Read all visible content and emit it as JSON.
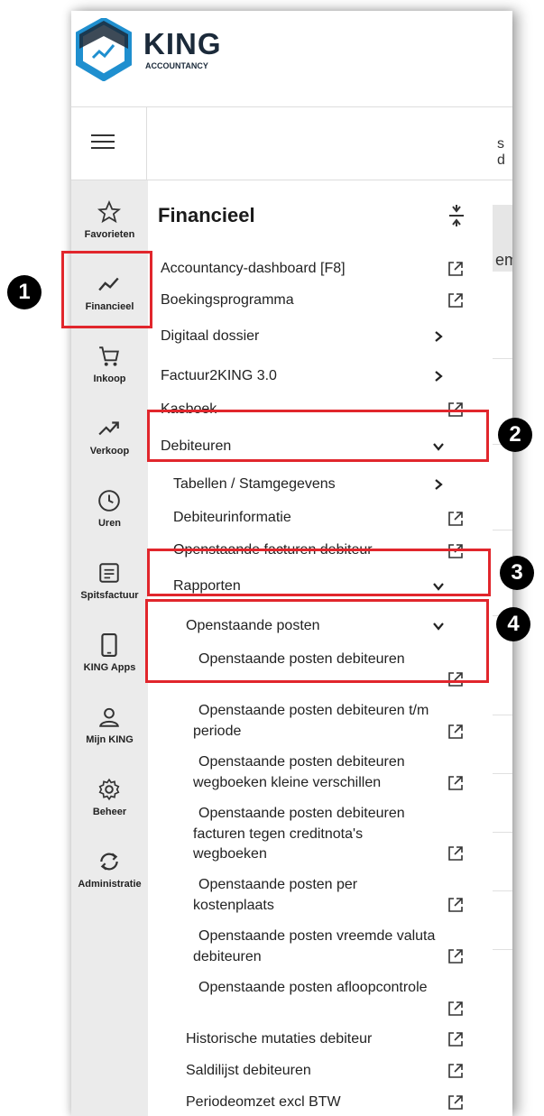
{
  "brand": {
    "name": "KING",
    "sub": "ACCOUNTANCY"
  },
  "topbar": {
    "peek_text": "s d"
  },
  "rail": [
    {
      "label": "Favorieten",
      "icon": "star-icon"
    },
    {
      "label": "Financieel",
      "icon": "line-chart-icon",
      "active": true
    },
    {
      "label": "Inkoop",
      "icon": "cart-icon"
    },
    {
      "label": "Verkoop",
      "icon": "trending-up-icon"
    },
    {
      "label": "Uren",
      "icon": "clock-icon"
    },
    {
      "label": "Spitsfactuur",
      "icon": "document-icon"
    },
    {
      "label": "KING Apps",
      "icon": "phone-icon"
    },
    {
      "label": "Mijn KING",
      "icon": "user-icon"
    },
    {
      "label": "Beheer",
      "icon": "gear-icon"
    },
    {
      "label": "Administratie",
      "icon": "sync-icon"
    }
  ],
  "panel": {
    "title": "Financieel",
    "items": [
      {
        "label": "Accountancy-dashboard [F8]",
        "kind": "external"
      },
      {
        "label": "Boekingsprogramma",
        "kind": "external"
      },
      {
        "label": "Digitaal dossier",
        "kind": "submenu"
      },
      {
        "label": "Factuur2KING 3.0",
        "kind": "submenu"
      },
      {
        "label": "Kasboek",
        "kind": "external"
      },
      {
        "label": "Debiteuren",
        "kind": "expanded"
      },
      {
        "label": "Tabellen / Stamgegevens",
        "kind": "submenu"
      },
      {
        "label": "Debiteurinformatie",
        "kind": "external"
      },
      {
        "label": "Openstaande facturen debiteur",
        "kind": "external"
      },
      {
        "label": "Rapporten",
        "kind": "expanded"
      },
      {
        "label": "Openstaande posten",
        "kind": "expanded"
      },
      {
        "label": "Openstaande posten debiteuren",
        "kind": "external"
      },
      {
        "line1": "Openstaande posten debiteuren t/m",
        "line2": "periode",
        "kind": "external"
      },
      {
        "line1": "Openstaande posten debiteuren",
        "line2": "wegboeken kleine verschillen",
        "kind": "external"
      },
      {
        "line1": "Openstaande posten debiteuren",
        "line2": "facturen tegen creditnota's",
        "line3": "wegboeken",
        "kind": "external"
      },
      {
        "line1": "Openstaande posten per",
        "line2": "kostenplaats",
        "kind": "external"
      },
      {
        "line1": "Openstaande posten vreemde valuta",
        "line2": "debiteuren",
        "kind": "external"
      },
      {
        "label": "Openstaande posten afloopcontrole",
        "kind": "external"
      },
      {
        "label": "Historische mutaties debiteur",
        "kind": "external"
      },
      {
        "label": "Saldilijst debiteuren",
        "kind": "external"
      },
      {
        "label": "Periodeomzet excl BTW",
        "kind": "external"
      }
    ]
  },
  "right_peek": {
    "text": "em"
  },
  "annotations": [
    "1",
    "2",
    "3",
    "4"
  ],
  "colors": {
    "highlight": "#e1262c",
    "brand_blue": "#1f8fcf",
    "brand_dark": "#1b2a3a"
  }
}
